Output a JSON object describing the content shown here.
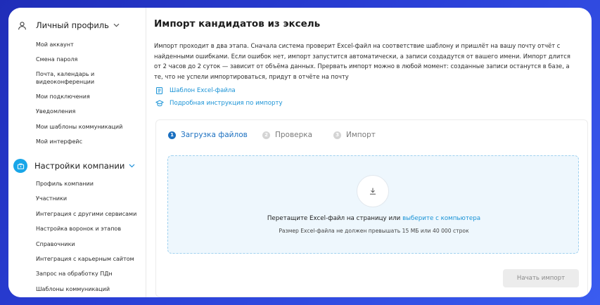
{
  "sidebar": {
    "personal": {
      "label": "Личный профиль",
      "items": [
        "Мой аккаунт",
        "Смена пароля",
        "Почта, календарь и видеоконференции",
        "Мои подключения",
        "Уведомления",
        "Мои шаблоны коммуникаций",
        "Мой интерфейс"
      ]
    },
    "company": {
      "label": "Настройки компании",
      "items": [
        "Профиль компании",
        "Участники",
        "Интеграция с другими сервисами",
        "Настройка воронок и этапов",
        "Справочники",
        "Интеграция с карьерным сайтом",
        "Запрос на обработку ПДн",
        "Шаблоны коммуникаций"
      ]
    }
  },
  "main": {
    "title": "Импорт кандидатов из эксель",
    "intro": "Импорт проходит в два этапа. Сначала система проверит Excel-файл на соответствие шаблону и пришлёт на вашу почту отчёт с найденными ошибками. Если ошибок нет, импорт запустится автоматически, а записи создадутся от вашего имени. Импорт длится от 2 часов до 2 суток — зависит от объёма данных. Прервать импорт можно в любой момент: созданные записи останутся в базе, а те, что не успели импортироваться, придут в отчёте на почту",
    "template_link": "Шаблон Excel-файла",
    "instructions_link": "Подробная инструкция по импорту",
    "steps": [
      {
        "num": "1",
        "label": "Загрузка файлов"
      },
      {
        "num": "2",
        "label": "Проверка"
      },
      {
        "num": "3",
        "label": "Импорт"
      }
    ],
    "drop": {
      "text": "Перетащите Excel-файл на страницу или",
      "pick": "выберите с компьютера",
      "hint": "Размер Excel-файла не должен превышать 15 МБ или 40 000 строк"
    },
    "start_button": "Начать импорт"
  },
  "colors": {
    "accent": "#1a93d6",
    "step_active": "#1a6fc0",
    "company_icon": "#19a6e8",
    "drop_bg": "#eef7fd",
    "frame_gradient": "#2a3fd6"
  },
  "icons": {
    "personal": "user-icon",
    "company": "briefcase-icon",
    "template": "spreadsheet-icon",
    "instructions": "graduation-cap-icon",
    "upload": "download-arrow-icon"
  }
}
